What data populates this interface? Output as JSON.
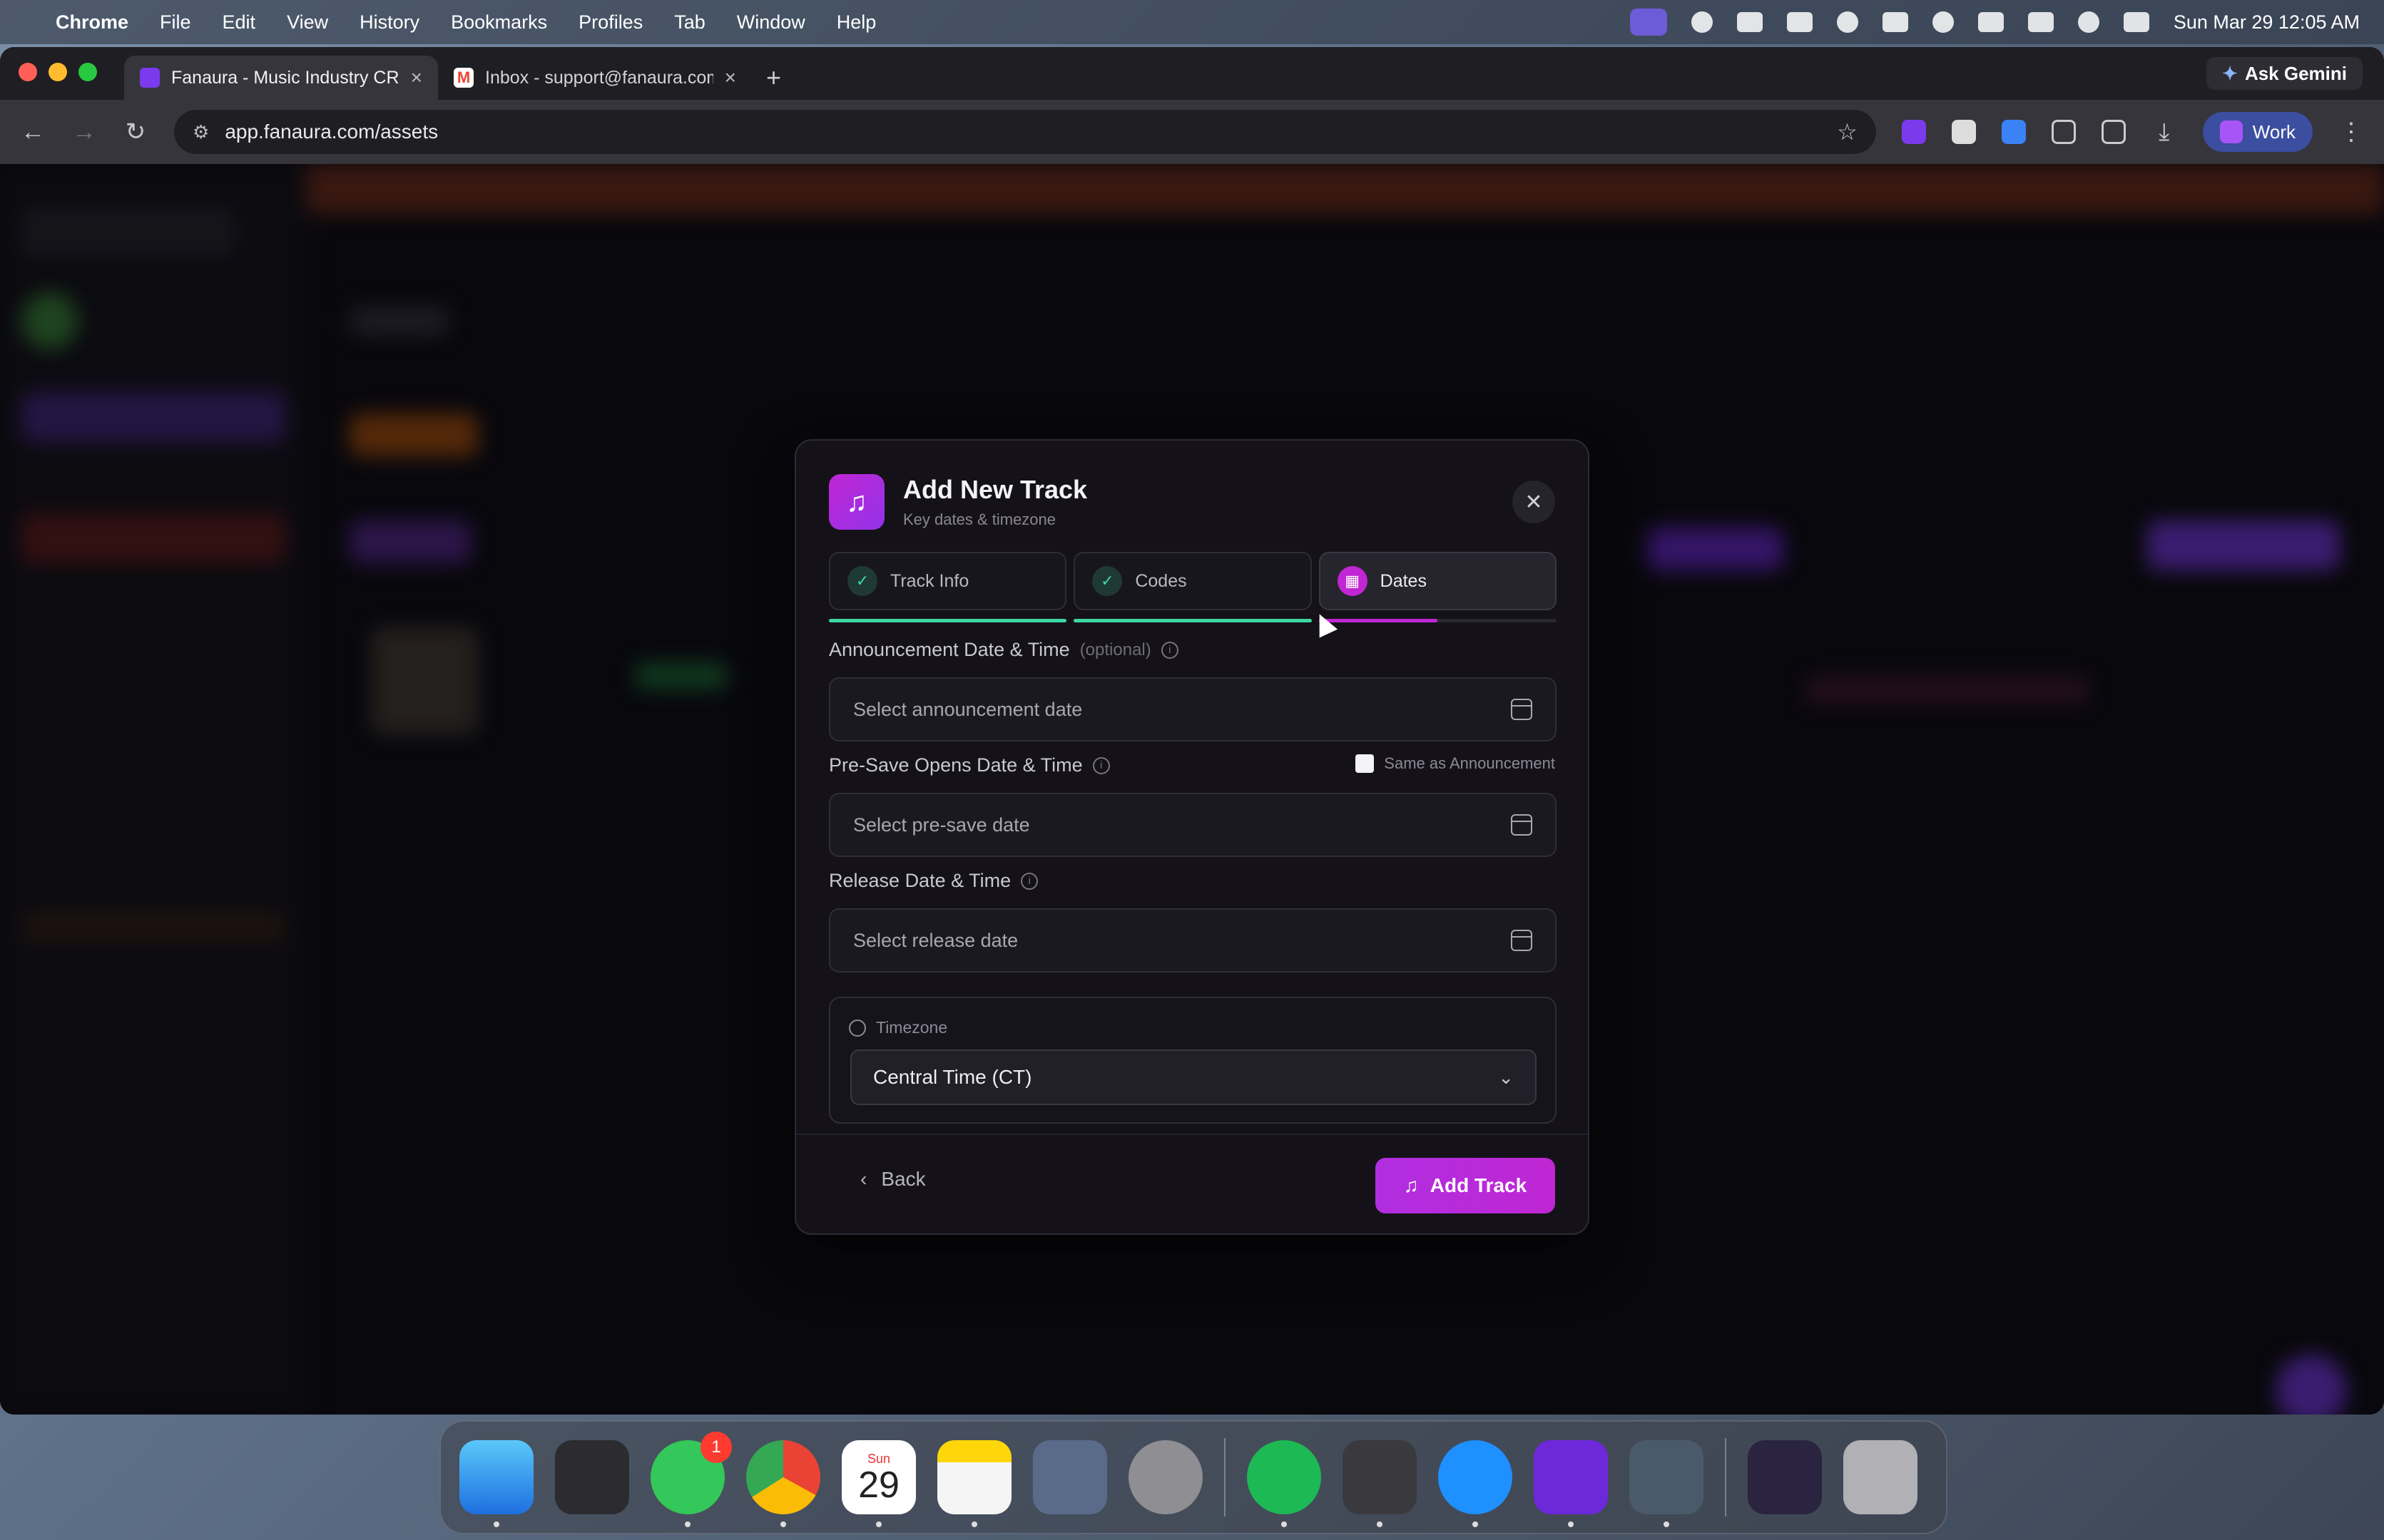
{
  "menubar": {
    "app_name": "Chrome",
    "items": [
      "File",
      "Edit",
      "View",
      "History",
      "Bookmarks",
      "Profiles",
      "Tab",
      "Window",
      "Help"
    ],
    "clock": "Sun Mar 29  12:05 AM"
  },
  "browser": {
    "tabs": [
      {
        "title": "Fanaura - Music Industry CRM",
        "active": true,
        "favicon_color": "#7c3aed"
      },
      {
        "title": "Inbox - support@fanaura.com",
        "active": false,
        "favicon_color": "#ea4335"
      }
    ],
    "ask_gemini_label": "Ask Gemini",
    "url": "app.fanaura.com/assets",
    "profile_label": "Work"
  },
  "modal": {
    "title": "Add New Track",
    "subtitle": "Key dates & timezone",
    "steps": [
      {
        "label": "Track Info",
        "state": "done",
        "progress": 1.0
      },
      {
        "label": "Codes",
        "state": "done",
        "progress": 1.0
      },
      {
        "label": "Dates",
        "state": "current",
        "progress": 0.5
      }
    ],
    "announcement": {
      "label": "Announcement Date & Time",
      "optional": "(optional)",
      "placeholder": "Select announcement date"
    },
    "presave": {
      "label": "Pre-Save Opens Date & Time",
      "placeholder": "Select pre-save date",
      "same_as_label": "Same as Announcement",
      "same_as_checked": false
    },
    "release": {
      "label": "Release Date & Time",
      "placeholder": "Select release date"
    },
    "timezone": {
      "label": "Timezone",
      "selected": "Central Time (CT)"
    },
    "back_label": "Back",
    "submit_label": "Add Track"
  },
  "dock": {
    "calendar_month": "Sun",
    "calendar_day": "29",
    "messages_badge": "1"
  },
  "colors": {
    "accent": "#c026d3",
    "done_green": "#3fd6a2"
  }
}
